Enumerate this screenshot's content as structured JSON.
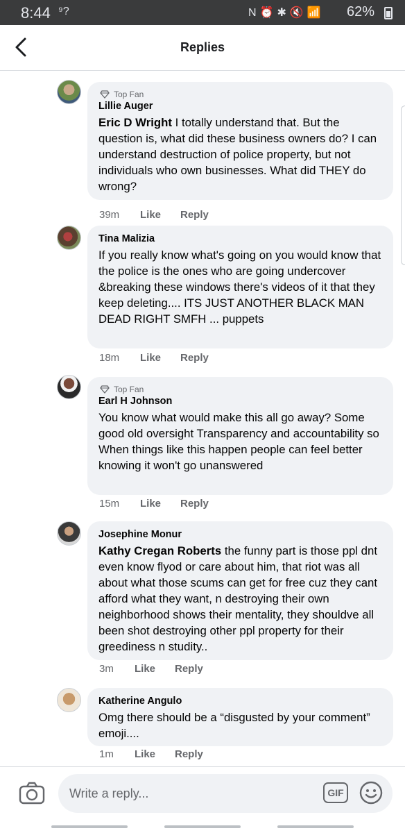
{
  "status_bar": {
    "time": "8:44",
    "time_icon": "signal-clock-icon",
    "icons": "N⏰✱🔇📶",
    "battery": "62%"
  },
  "header": {
    "title": "Replies",
    "back_icon": "back-arrow-icon"
  },
  "replies": [
    {
      "badge": "Top Fan",
      "author": "Lillie Auger",
      "mention": "Eric D Wright",
      "text": " I totally understand that. But the question is, what did these business owners do? I can understand destruction of police property, but not individuals who own businesses. What did THEY do wrong?",
      "time": "39m",
      "like": "Like",
      "reply": "Reply",
      "avatar_color": "#7a6a5a"
    },
    {
      "badge": "",
      "author": "Tina Malizia",
      "mention": "",
      "text": "If you really know what's going on you would know that the police is the ones who are going undercover &breaking these windows there's videos of it that they keep deleting.... ITS JUST ANOTHER BLACK MAN DEAD RIGHT SMFH ... puppets",
      "time": "18m",
      "like": "Like",
      "reply": "Reply",
      "avatar_color": "#5a4a3a"
    },
    {
      "badge": "Top Fan",
      "author": "Earl H Johnson",
      "mention": "",
      "text": "You know what would make this all go away? Some good old oversight Transparency and accountability so When things like this happen people can feel better knowing it won't go unanswered",
      "time": "15m",
      "like": "Like",
      "reply": "Reply",
      "avatar_color": "#8a3a2a"
    },
    {
      "badge": "",
      "author": "Josephine Monur",
      "mention": "Kathy Cregan Roberts",
      "text": " the funny part is those ppl dnt even know flyod or care about him, that riot was all about what those scums can get for free cuz they cant afford what they want, n destroying their own neighborhood shows their mentality, they shouldve all been shot destroying other ppl property for their greediness n studity..",
      "time": "3m",
      "like": "Like",
      "reply": "Reply",
      "avatar_color": "#4a4a4a"
    },
    {
      "badge": "",
      "author": "Katherine Angulo",
      "mention": "",
      "text": "Omg  there should be a “disgusted by your comment” emoji....",
      "time": "1m",
      "like": "Like",
      "reply": "Reply",
      "avatar_color": "#b08a60"
    }
  ],
  "composer": {
    "placeholder": "Write a reply...",
    "gif_label": "GIF",
    "camera_icon": "camera-icon",
    "emoji_icon": "emoji-icon"
  },
  "colors": {
    "bubble": "#f0f2f5",
    "meta_text": "#65676b",
    "status_bar": "#3a3b3c"
  }
}
